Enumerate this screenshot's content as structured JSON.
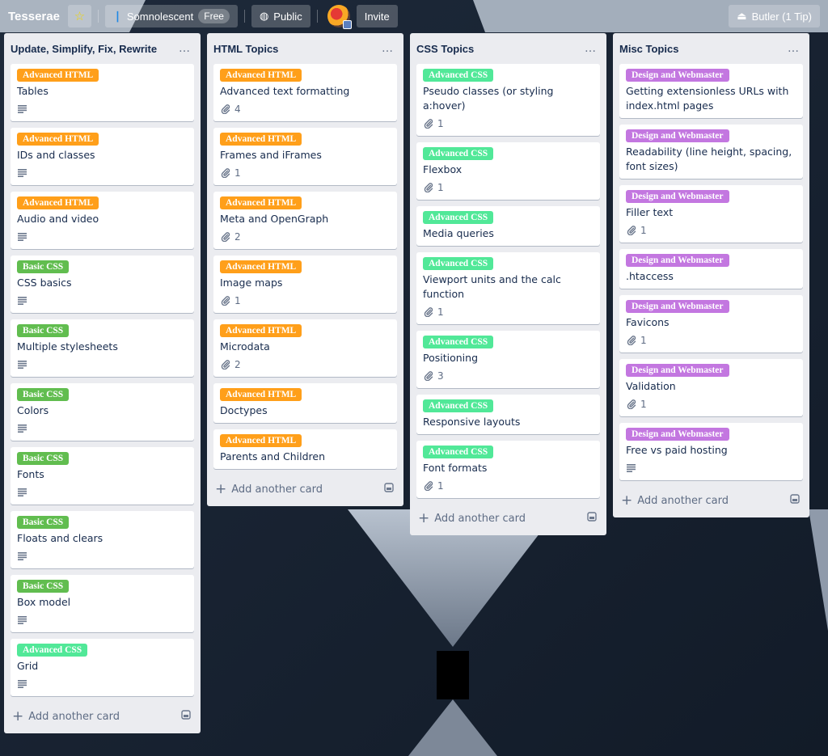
{
  "header": {
    "board_title": "Tesserae",
    "star_icon": "star-icon",
    "workspace_name": "Somnolescent",
    "workspace_badge": "Free",
    "visibility": "Public",
    "invite": "Invite",
    "butler": "Butler (1 Tip)"
  },
  "colors": {
    "advanced_html": "#ff9f1a",
    "basic_css": "#61bd4f",
    "advanced_css": "#51e898",
    "design_webmaster": "#c377e0",
    "list_bg": "#ebecf0",
    "card_bg": "#ffffff"
  },
  "lists": [
    {
      "title": "Update, Simplify, Fix, Rewrite",
      "menu": "…",
      "add_label": "Add another card",
      "cards": [
        {
          "label": "Advanced HTML",
          "label_type": "advanced_html",
          "title": "Tables",
          "badge": "description"
        },
        {
          "label": "Advanced HTML",
          "label_type": "advanced_html",
          "title": "IDs and classes",
          "badge": "description"
        },
        {
          "label": "Advanced HTML",
          "label_type": "advanced_html",
          "title": "Audio and video",
          "badge": "description"
        },
        {
          "label": "Basic CSS",
          "label_type": "basic_css",
          "title": "CSS basics",
          "badge": "description"
        },
        {
          "label": "Basic CSS",
          "label_type": "basic_css",
          "title": "Multiple stylesheets",
          "badge": "description"
        },
        {
          "label": "Basic CSS",
          "label_type": "basic_css",
          "title": "Colors",
          "badge": "description"
        },
        {
          "label": "Basic CSS",
          "label_type": "basic_css",
          "title": "Fonts",
          "badge": "description"
        },
        {
          "label": "Basic CSS",
          "label_type": "basic_css",
          "title": "Floats and clears",
          "badge": "description"
        },
        {
          "label": "Basic CSS",
          "label_type": "basic_css",
          "title": "Box model",
          "badge": "description"
        },
        {
          "label": "Advanced CSS",
          "label_type": "advanced_css",
          "title": "Grid",
          "badge": "description"
        }
      ]
    },
    {
      "title": "HTML Topics",
      "menu": "…",
      "add_label": "Add another card",
      "cards": [
        {
          "label": "Advanced HTML",
          "label_type": "advanced_html",
          "title": "Advanced text formatting",
          "badge": "attachment",
          "count": "4"
        },
        {
          "label": "Advanced HTML",
          "label_type": "advanced_html",
          "title": "Frames and iFrames",
          "badge": "attachment",
          "count": "1"
        },
        {
          "label": "Advanced HTML",
          "label_type": "advanced_html",
          "title": "Meta and OpenGraph",
          "badge": "attachment",
          "count": "2"
        },
        {
          "label": "Advanced HTML",
          "label_type": "advanced_html",
          "title": "Image maps",
          "badge": "attachment",
          "count": "1"
        },
        {
          "label": "Advanced HTML",
          "label_type": "advanced_html",
          "title": "Microdata",
          "badge": "attachment",
          "count": "2"
        },
        {
          "label": "Advanced HTML",
          "label_type": "advanced_html",
          "title": "Doctypes",
          "badge": "none"
        },
        {
          "label": "Advanced HTML",
          "label_type": "advanced_html",
          "title": "Parents and Children",
          "badge": "none"
        }
      ]
    },
    {
      "title": "CSS Topics",
      "menu": "…",
      "add_label": "Add another card",
      "cards": [
        {
          "label": "Advanced CSS",
          "label_type": "advanced_css",
          "title": "Pseudo classes (or styling a:hover)",
          "badge": "attachment",
          "count": "1"
        },
        {
          "label": "Advanced CSS",
          "label_type": "advanced_css",
          "title": "Flexbox",
          "badge": "attachment",
          "count": "1"
        },
        {
          "label": "Advanced CSS",
          "label_type": "advanced_css",
          "title": "Media queries",
          "badge": "none"
        },
        {
          "label": "Advanced CSS",
          "label_type": "advanced_css",
          "title": "Viewport units and the calc function",
          "badge": "attachment",
          "count": "1"
        },
        {
          "label": "Advanced CSS",
          "label_type": "advanced_css",
          "title": "Positioning",
          "badge": "attachment",
          "count": "3"
        },
        {
          "label": "Advanced CSS",
          "label_type": "advanced_css",
          "title": "Responsive layouts",
          "badge": "none"
        },
        {
          "label": "Advanced CSS",
          "label_type": "advanced_css",
          "title": "Font formats",
          "badge": "attachment",
          "count": "1"
        }
      ]
    },
    {
      "title": "Misc Topics",
      "menu": "…",
      "add_label": "Add another card",
      "cards": [
        {
          "label": "Design and Webmaster",
          "label_type": "design_webmaster",
          "title": "Getting extensionless URLs with index.html pages",
          "badge": "none"
        },
        {
          "label": "Design and Webmaster",
          "label_type": "design_webmaster",
          "title": "Readability (line height, spacing, font sizes)",
          "badge": "none"
        },
        {
          "label": "Design and Webmaster",
          "label_type": "design_webmaster",
          "title": "Filler text",
          "badge": "attachment",
          "count": "1"
        },
        {
          "label": "Design and Webmaster",
          "label_type": "design_webmaster",
          "title": ".htaccess",
          "badge": "none"
        },
        {
          "label": "Design and Webmaster",
          "label_type": "design_webmaster",
          "title": "Favicons",
          "badge": "attachment",
          "count": "1"
        },
        {
          "label": "Design and Webmaster",
          "label_type": "design_webmaster",
          "title": "Validation",
          "badge": "attachment",
          "count": "1"
        },
        {
          "label": "Design and Webmaster",
          "label_type": "design_webmaster",
          "title": "Free vs paid hosting",
          "badge": "description"
        }
      ]
    }
  ]
}
